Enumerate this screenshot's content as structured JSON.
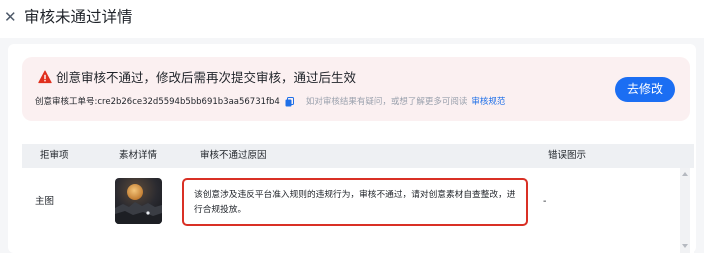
{
  "dialog": {
    "close_glyph": "✕",
    "title": "审核未通过详情"
  },
  "alert": {
    "title": "创意审核不通过，修改后需再次提交审核，通过后生效",
    "ticket_label": "创意审核工单号:",
    "ticket_id": "cre2b26ce32d5594b5bb691b3aa56731fb4",
    "hint": "如对审核结果有疑问，或想了解更多可阅读",
    "rules_link": "审核规范",
    "modify_button": "去修改",
    "icon": "warning-triangle-icon",
    "warning_color": "#e0301e",
    "button_color": "#1b6ef3"
  },
  "table": {
    "headers": {
      "item": "拒审项",
      "material": "素材详情",
      "reason": "审核不通过原因",
      "error_image": "错误图示"
    },
    "rows": [
      {
        "item": "主图",
        "thumbnail": "moon-night-scenery-image",
        "reason": "该创意涉及违反平台准入规则的违规行为，审核不通过，请对创意素材自查整改，进行合规投放。",
        "error_image": "-"
      }
    ]
  }
}
